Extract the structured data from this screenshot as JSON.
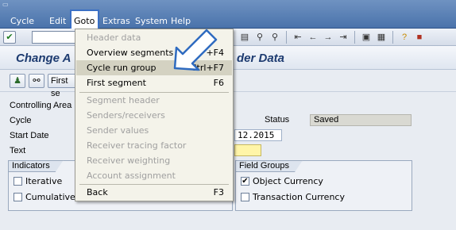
{
  "menubar": {
    "items": [
      "Cycle",
      "Edit",
      "Goto",
      "Extras",
      "System",
      "Help"
    ]
  },
  "toolbar": {
    "ok_glyph": "✔",
    "icons": [
      "save-icon",
      "find-icon",
      "find-next-icon",
      "first-page-icon",
      "prev-page-icon",
      "next-page-icon",
      "last-page-icon",
      "create-session-icon",
      "shortcut-icon",
      "help-icon",
      "customize-icon"
    ]
  },
  "title": {
    "left": "Change A",
    "right": "der Data"
  },
  "apptoolbar": {
    "first_button": "First se"
  },
  "form": {
    "controlling_area": "Controlling Area",
    "cycle": "Cycle",
    "start_date": "Start Date",
    "start_date_value": "12.2015",
    "text": "Text",
    "status_label": "Status",
    "status_value": "Saved"
  },
  "indicators": {
    "title": "Indicators",
    "iterative": "Iterative",
    "cumulative": "Cumulative"
  },
  "field_groups": {
    "title": "Field Groups",
    "object_currency": "Object Currency",
    "object_currency_checked": "✔",
    "transaction_currency": "Transaction Currency"
  },
  "dropdown": {
    "items": [
      {
        "label": "Header data",
        "shortcut": "",
        "disabled": true
      },
      {
        "label": "Overview segments",
        "shortcut": "+F4",
        "disabled": false
      },
      {
        "label": "Cycle run group",
        "shortcut": "Ctrl+F7",
        "disabled": false
      },
      {
        "label": "First segment",
        "shortcut": "F6",
        "disabled": false
      },
      {
        "label": "Segment header",
        "shortcut": "",
        "disabled": true
      },
      {
        "label": "Senders/receivers",
        "shortcut": "",
        "disabled": true
      },
      {
        "label": "Sender values",
        "shortcut": "",
        "disabled": true
      },
      {
        "label": "Receiver tracing factor",
        "shortcut": "",
        "disabled": true
      },
      {
        "label": "Receiver weighting",
        "shortcut": "",
        "disabled": true
      },
      {
        "label": "Account assignment",
        "shortcut": "",
        "disabled": true
      },
      {
        "label": "Back",
        "shortcut": "F3",
        "disabled": false
      }
    ]
  },
  "colors": {
    "menubar": "#4a73ab",
    "highlight_border": "#3a6fc4",
    "required_field": "#fff5a8"
  }
}
